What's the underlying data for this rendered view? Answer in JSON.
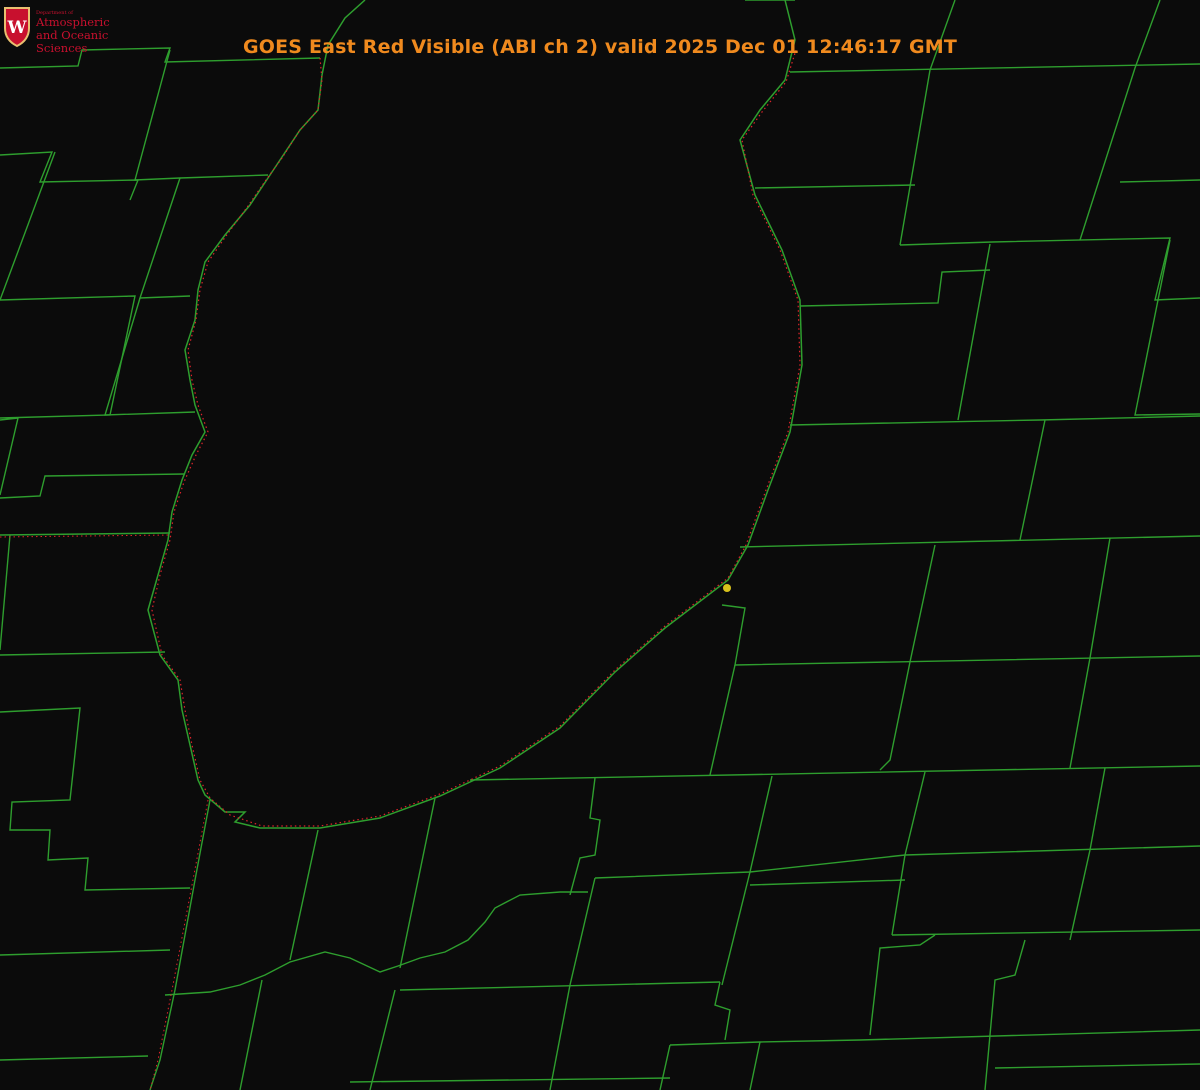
{
  "title": "GOES East Red Visible (ABI ch 2) valid 2025 Dec 01 12:46:17 GMT",
  "logo": {
    "dept": "Department of",
    "line1": "Atmospheric",
    "line2": "and Oceanic Sciences",
    "icon": "uw-crest-icon"
  },
  "colors": {
    "background": "#0b0b0b",
    "title": "#f08a1e",
    "county_lines": "#2e9e2e",
    "coastline_dots": "#e0242b",
    "marker": "#d8c21c",
    "logo_text": "#c8102e"
  }
}
